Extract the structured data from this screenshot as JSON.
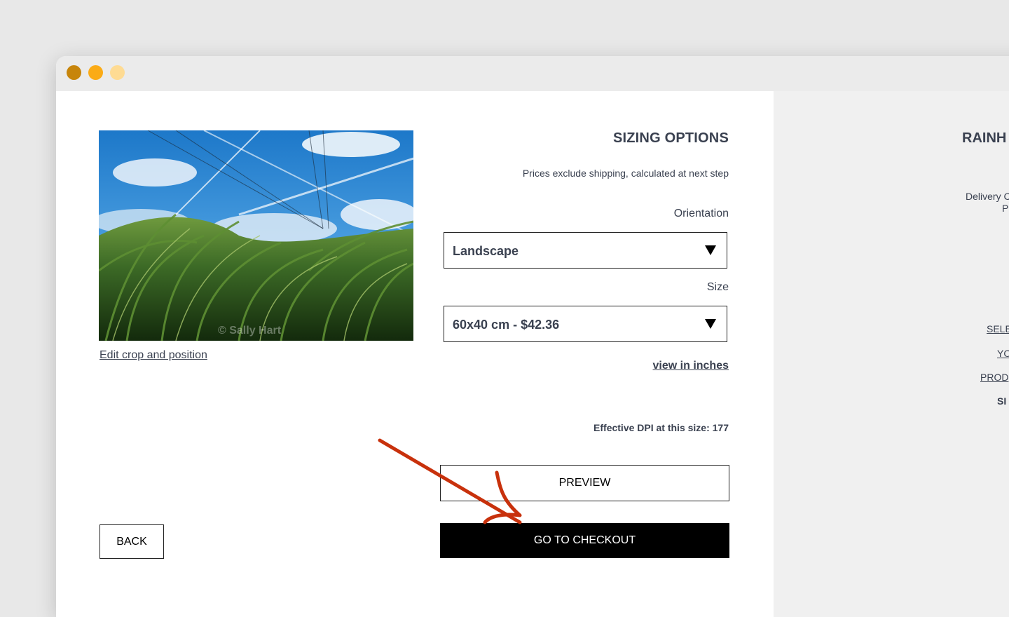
{
  "window": {
    "controls": [
      "close",
      "minimize",
      "maximize"
    ],
    "control_colors": [
      "#c7850b",
      "#fbab16",
      "#fedb93"
    ]
  },
  "image": {
    "description_icon": "photo-grass-sky",
    "watermark": "© Sally Hart",
    "edit_link": "Edit crop and position"
  },
  "sizing": {
    "title": "SIZING OPTIONS",
    "shipping_note": "Prices exclude shipping, calculated at next step",
    "orientation_label": "Orientation",
    "orientation_value": "Landscape",
    "size_label": "Size",
    "size_value": "60x40 cm - $42.36",
    "inches_link": "view in inches",
    "dpi_note": "Effective DPI at this size: 177"
  },
  "buttons": {
    "preview": "PREVIEW",
    "back": "BACK",
    "checkout": "GO TO CHECKOUT"
  },
  "annotation": {
    "arrow_color": "#c8310c"
  },
  "sidebar": {
    "title": "RAINH",
    "delivery_line1": "Delivery C",
    "delivery_line2": "P",
    "nav": [
      "SELE",
      "YO",
      "PROD",
      "SI"
    ]
  }
}
